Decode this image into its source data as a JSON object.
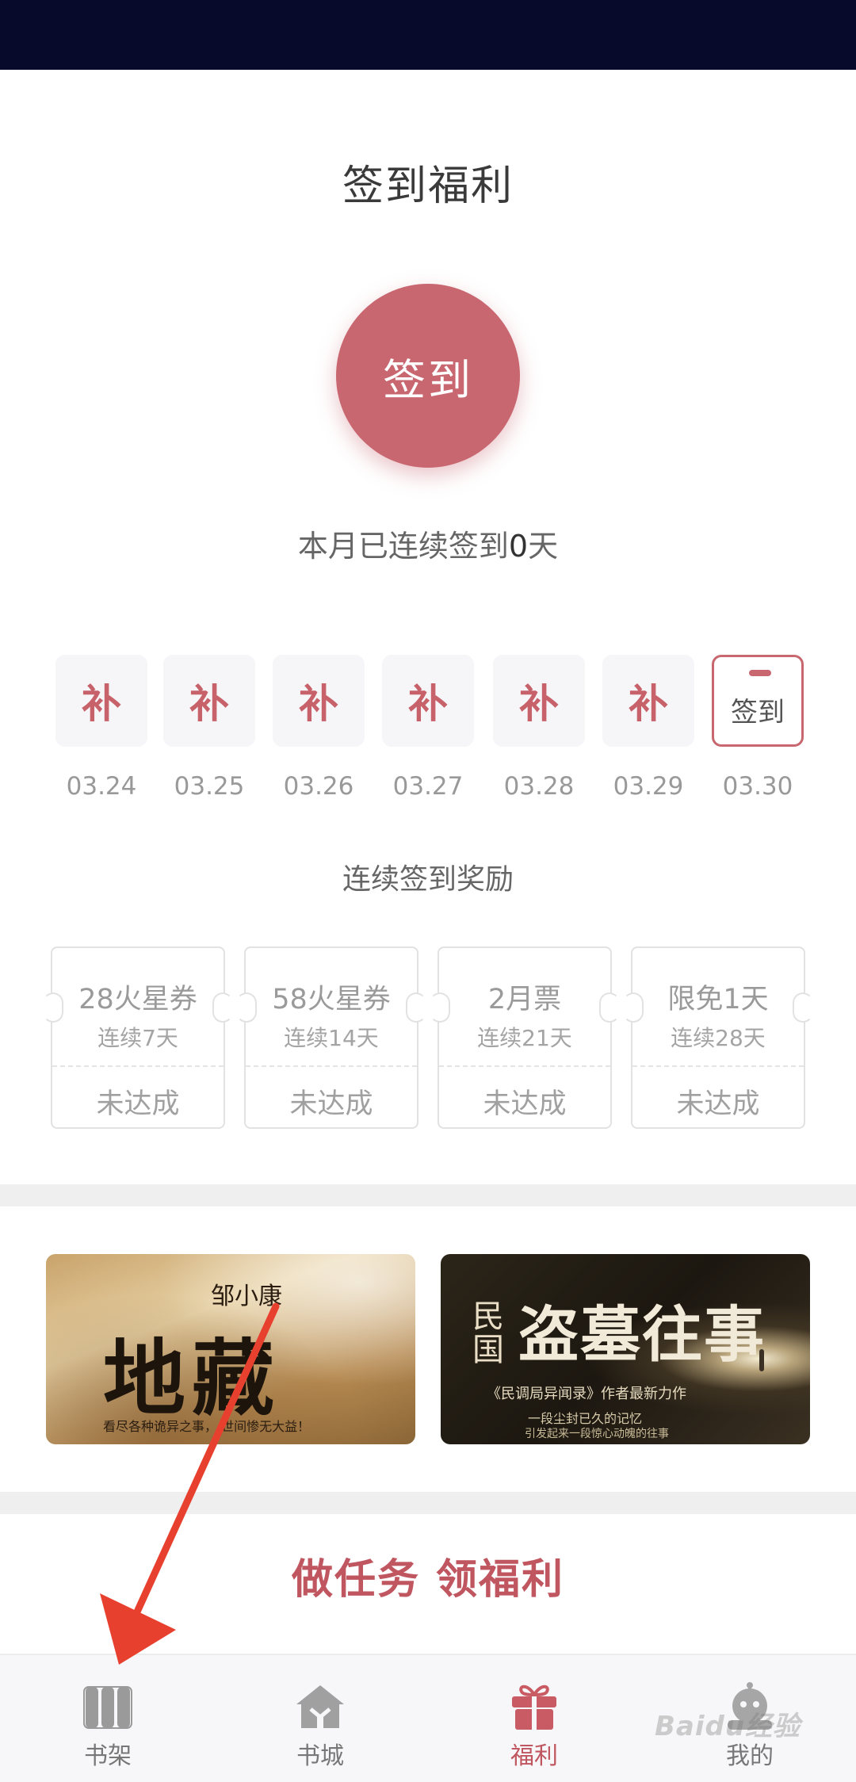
{
  "page": {
    "title": "签到福利",
    "signin_button": "签到",
    "streak_prefix": "本月已连续签到",
    "streak_days": "0",
    "streak_suffix": "天"
  },
  "days": [
    {
      "label": "补",
      "date": "03.24"
    },
    {
      "label": "补",
      "date": "03.25"
    },
    {
      "label": "补",
      "date": "03.26"
    },
    {
      "label": "补",
      "date": "03.27"
    },
    {
      "label": "补",
      "date": "03.28"
    },
    {
      "label": "补",
      "date": "03.29"
    },
    {
      "label": "签到",
      "date": "03.30"
    }
  ],
  "rewards_title": "连续签到奖励",
  "rewards": [
    {
      "name": "28火星券",
      "condition": "连续7天",
      "status": "未达成"
    },
    {
      "name": "58火星券",
      "condition": "连续14天",
      "status": "未达成"
    },
    {
      "name": "2月票",
      "condition": "连续21天",
      "status": "未达成"
    },
    {
      "name": "限免1天",
      "condition": "连续28天",
      "status": "未达成"
    }
  ],
  "banners": {
    "b1": {
      "author": "邹小康",
      "title": "地藏",
      "subtitle": "看尽各种诡异之事，  世间惨无大益！"
    },
    "b2": {
      "prefix": "民国",
      "title": "盗墓往事",
      "tag": "《民调局异闻录》作者最新力作",
      "line1": "一段尘封已久的记忆",
      "line2": "引发起来一段惊心动魄的往事"
    }
  },
  "task_title": "做任务 领福利",
  "tabbar": [
    {
      "label": "书架",
      "icon": "bookshelf-icon"
    },
    {
      "label": "书城",
      "icon": "bookstore-icon"
    },
    {
      "label": "福利",
      "icon": "gift-icon",
      "active": true
    },
    {
      "label": "我的",
      "icon": "profile-icon"
    }
  ],
  "watermark": "Baidu经验",
  "colors": {
    "accent": "#c86770",
    "statusbar": "#070a2b",
    "arrow": "#e8402f"
  }
}
